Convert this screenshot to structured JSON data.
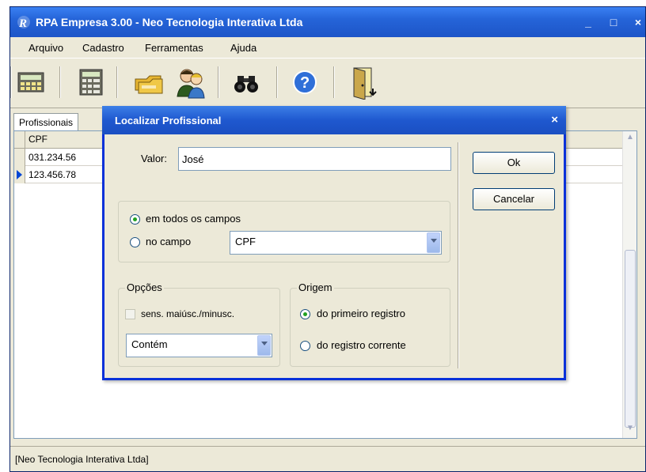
{
  "window": {
    "title": "RPA Empresa 3.00 - Neo Tecnologia Interativa Ltda",
    "minimize": "_",
    "maximize": "□",
    "close": "×"
  },
  "menu": [
    {
      "label": "Arquivo"
    },
    {
      "label": "Cadastro"
    },
    {
      "label": "Ferramentas"
    },
    {
      "label": "Ajuda"
    }
  ],
  "toolbar": {
    "icons": [
      "calculator-icon",
      "calculator2-icon",
      "folders-icon",
      "users-icon",
      "binoculars-icon",
      "help-icon",
      "exit-door-icon"
    ]
  },
  "tab": {
    "label": "Profissionais"
  },
  "grid": {
    "header": "CPF",
    "rows": [
      "031.234.56",
      "123.456.78"
    ]
  },
  "status": {
    "text": "[Neo Tecnologia Interativa Ltda]"
  },
  "dialog": {
    "title": "Localizar Profissional",
    "close": "×",
    "valor_label": "Valor:",
    "valor_value": "José",
    "scope": {
      "all_fields_label": "em todos os campos",
      "field_label": "no campo",
      "field_selected": "CPF",
      "selected": "all"
    },
    "opcoes": {
      "title": "Opções",
      "case_label": "sens. maiúsc./minusc.",
      "case_checked": false,
      "match_selected": "Contém"
    },
    "origem": {
      "title": "Origem",
      "first_label": "do primeiro registro",
      "current_label": "do registro corrente",
      "selected": "first"
    },
    "ok_label": "Ok",
    "cancel_label": "Cancelar"
  },
  "colors": {
    "titlebar": "#2564d8",
    "dialog_title": "#1f58cf",
    "face": "#ece9d8"
  }
}
